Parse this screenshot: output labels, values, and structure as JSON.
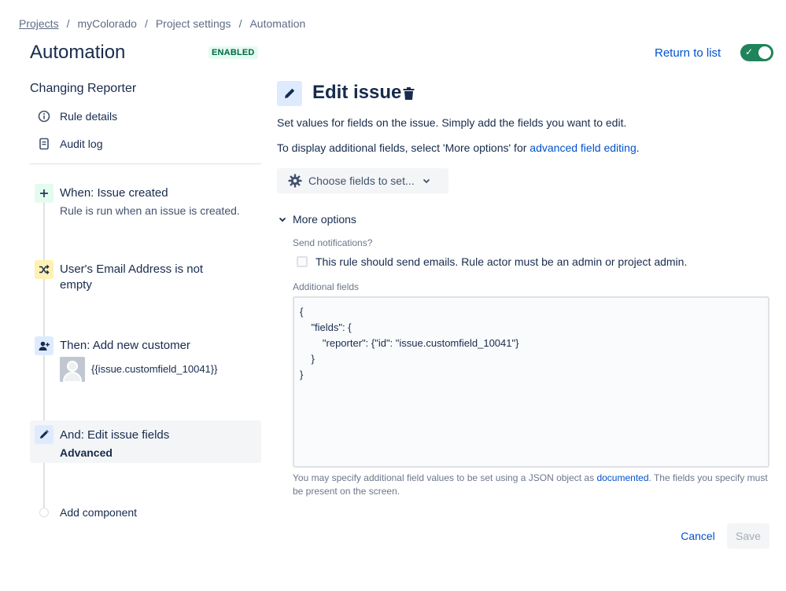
{
  "breadcrumb": {
    "items": [
      "Projects",
      "myColorado",
      "Project settings",
      "Automation"
    ],
    "separator": "/"
  },
  "header": {
    "title": "Automation",
    "status": "ENABLED",
    "return_link": "Return to list",
    "toggle_on": true,
    "toggle_icon": "check-icon"
  },
  "sidebar": {
    "rule_name": "Changing Reporter",
    "links": [
      {
        "label": "Rule details",
        "icon": "info-icon"
      },
      {
        "label": "Audit log",
        "icon": "document-icon"
      }
    ],
    "components": [
      {
        "title": "When: Issue created",
        "subtitle": "Rule is run when an issue is created.",
        "icon": "plus-icon",
        "color": "#e3fcef"
      },
      {
        "title": "User's Email Address is not empty",
        "icon": "shuffle-icon",
        "color": "#fff0b3"
      },
      {
        "title": "Then: Add new customer",
        "subtitle": "{{issue.customfield_10041}}",
        "icon": "add-user-icon",
        "color": "#deebff"
      },
      {
        "title": "And: Edit issue fields",
        "subtitle": "Advanced",
        "icon": "pencil-icon",
        "color": "#deebff"
      }
    ],
    "add_component": "Add component"
  },
  "main": {
    "title": "Edit issue",
    "description": "Set values for fields on the issue. Simply add the fields you want to edit.",
    "additional_prefix": "To display additional fields, select 'More options' for ",
    "additional_link": "advanced field editing",
    "additional_suffix": ".",
    "choose_fields_button": "Choose fields to set...",
    "more_options": "More options",
    "send_notifications_label": "Send notifications?",
    "send_notifications_checkbox": "This rule should send emails. Rule actor must be an admin or project admin.",
    "send_notifications_checked": false,
    "additional_fields_label": "Additional fields",
    "additional_fields_value": "{\n    \"fields\": {\n        \"reporter\": {\"id\": \"issue.customfield_10041\"}\n    }\n}",
    "help_prefix": "You may specify additional field values to be set using a JSON object as ",
    "help_link": "documented",
    "help_suffix": ". The fields you specify must be present on the screen.",
    "cancel_label": "Cancel",
    "save_label": "Save"
  },
  "colors": {
    "accent": "#0052cc",
    "toggle": "#1f845a",
    "enabled_bg": "#e3fcef",
    "enabled_text": "#006644"
  }
}
